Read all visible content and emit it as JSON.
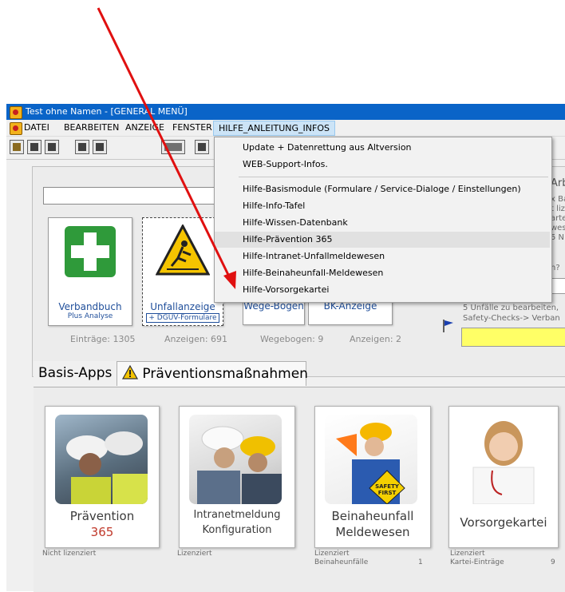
{
  "window": {
    "title": "Test ohne Namen - [GENERAL MENÜ]"
  },
  "menubar": [
    "DATEI",
    "BEARBEITEN",
    "ANZEIGE",
    "FENSTER",
    "HILFE_ANLEITUNG_INFOS"
  ],
  "toolbar_icons": [
    "open-folder-icon",
    "calculator-icon",
    "trash-icon",
    "print-icon",
    "save-icon",
    "prev-next-icon",
    "document-icon"
  ],
  "dropdown": {
    "group1": [
      "Update + Datenrettung aus Altversion",
      "WEB-Support-Infos."
    ],
    "group2": [
      "Hilfe-Basismodule (Formulare / Service-Dialoge / Einstellungen)",
      "Hilfe-Info-Tafel",
      "Hilfe-Wissen-Datenbank",
      "Hilfe-Prävention 365",
      "Hilfe-Intranet-Unfallmeldewesen",
      "Hilfe-Beinaheunfall-Meldewesen",
      "Hilfe-Vorsorgekartei"
    ],
    "highlighted": "Hilfe-Prävention 365"
  },
  "tiles": [
    {
      "label": "Verbandbuch",
      "sub": "Plus Analyse",
      "count": "Einträge: 1305"
    },
    {
      "label": "Unfallanzeige",
      "sub": "+ DGUV-Formulare",
      "count": "Anzeigen: 691"
    },
    {
      "label": "Wege-Bogen",
      "sub": "",
      "count": "Wegebogen: 9"
    },
    {
      "label": "BK-Anzeige",
      "sub": "",
      "count": "Anzeigen: 2"
    }
  ],
  "right_panel": {
    "cut_texts": [
      "Arb",
      "x Ba",
      "t liz",
      "arte",
      "wes",
      "5 N",
      "n?"
    ],
    "line1": "5 Unfälle zu bearbeiten,",
    "line2": "Safety-Checks-> Verban"
  },
  "tabs": {
    "basis": "Basis-Apps",
    "praevention": "Präventionsmaßnahmen"
  },
  "cards": [
    {
      "line1": "Prävention",
      "line2": "365",
      "license": "Nicht lizenziert",
      "extra_label": "",
      "extra_value": ""
    },
    {
      "line1": "Intranetmeldung",
      "line2": "Konfiguration",
      "license": "Lizenziert",
      "extra_label": "",
      "extra_value": ""
    },
    {
      "line1": "Beinaheunfall",
      "line2": "Meldewesen",
      "license": "Lizenziert",
      "extra_label": "Beinaheunfälle",
      "extra_value": "1"
    },
    {
      "line1": "Vorsorgekartei",
      "line2": "",
      "license": "Lizenziert",
      "extra_label": "Kartei-Einträge",
      "extra_value": "9"
    }
  ],
  "colors": {
    "titlebar": "#0a64c8",
    "tile_text": "#1f4e9a",
    "accent_365": "#c0392b",
    "arrow": "#e01010",
    "input_yellow": "#ffff66"
  }
}
